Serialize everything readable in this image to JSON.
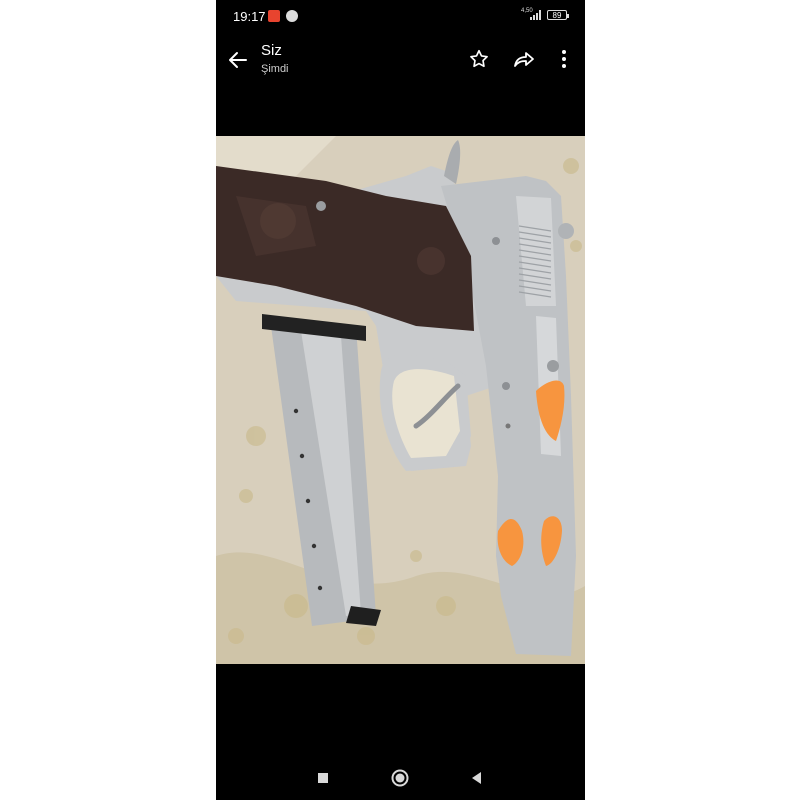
{
  "status_bar": {
    "time": "19:17",
    "network": "4,50",
    "network_unit": "",
    "battery": "89",
    "icons": [
      "mail-notification-icon",
      "blocked-icon",
      "signal-icon",
      "battery-icon"
    ]
  },
  "app_bar": {
    "title": "Siz",
    "subtitle": "Şimdi",
    "icons": [
      "back-arrow-icon",
      "star-icon",
      "forward-icon",
      "more-vertical-icon"
    ]
  },
  "photo": {
    "accent_marks_color": "#f7953f"
  },
  "nav_bar": {
    "icons": [
      "recents-square-icon",
      "home-circle-icon",
      "back-triangle-icon"
    ]
  }
}
